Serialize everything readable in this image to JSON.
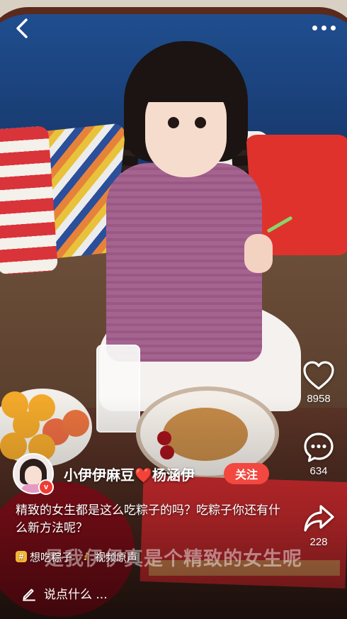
{
  "topbar": {
    "back_icon": "chevron-left-icon",
    "more_icon": "more-dots-icon"
  },
  "actions": {
    "like": {
      "icon": "heart-icon",
      "count": "8958"
    },
    "comment": {
      "icon": "comment-bubble-icon",
      "count": "634"
    },
    "share": {
      "icon": "share-arrow-icon",
      "count": "228"
    }
  },
  "author": {
    "name_prefix": "小伊伊麻豆",
    "heart": "❤️",
    "name_suffix": "杨涵伊",
    "verified_badge": "v",
    "follow_label": "关注"
  },
  "description": "精致的女生都是这么吃粽子的吗？吃粽子你还有什么新方法呢？",
  "tags": [
    {
      "icon": "hashtag-icon",
      "icon_text": "#",
      "label": "想吃粽子"
    },
    {
      "icon": "music-note-icon",
      "icon_text": "♪",
      "label": "视频原声"
    }
  ],
  "video_caption": "是我伊伊真是个精致的女生呢",
  "comment_bar": {
    "icon": "pen-icon",
    "placeholder": "说点什么 ..."
  },
  "colors": {
    "follow_button": "#f2483f",
    "badge": "#ef3b34",
    "tag_icon": "#f3b733",
    "text": "#ffffff"
  }
}
